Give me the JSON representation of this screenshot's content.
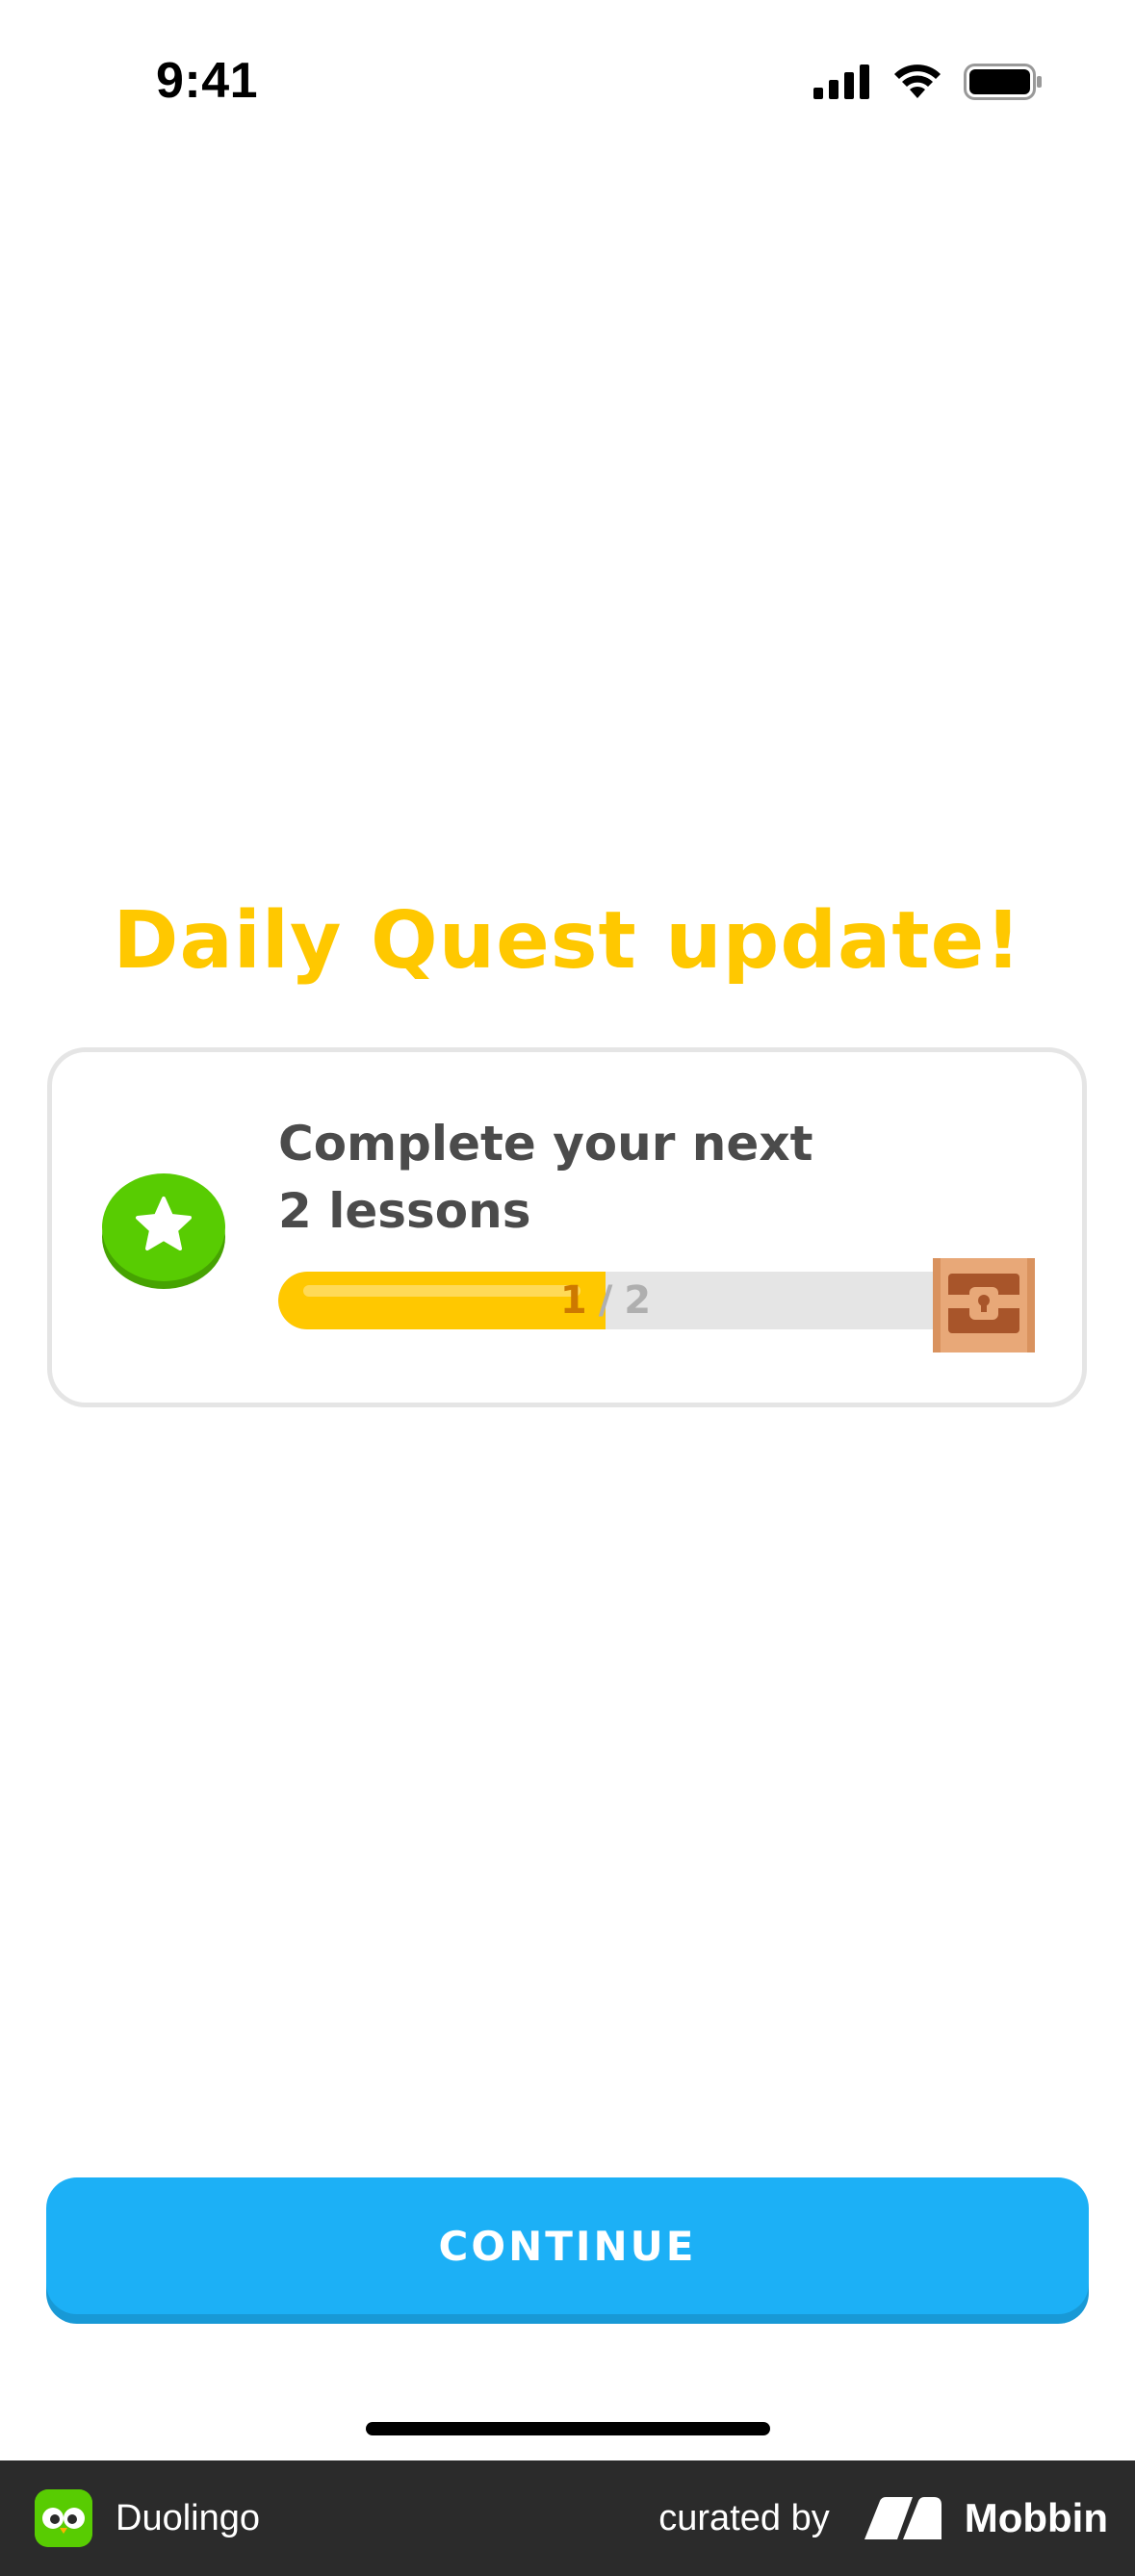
{
  "status_bar": {
    "time": "9:41"
  },
  "heading": "Daily Quest update!",
  "quest": {
    "title_line1": "Complete your next",
    "title_line2": "2 lessons",
    "progress": {
      "current": "1",
      "separator": "/",
      "total": "2",
      "fraction": 0.5
    },
    "icon": "star-badge-icon",
    "reward_icon": "treasure-chest-icon"
  },
  "continue_button": {
    "label": "CONTINUE"
  },
  "footer": {
    "app_name": "Duolingo",
    "curated_by": "curated by",
    "brand": "Mobbin"
  },
  "colors": {
    "heading": "#FFC800",
    "progress_fill": "#FFC800",
    "progress_track": "#E5E5E5",
    "button": "#1CB0F6",
    "star_badge": "#58CC02",
    "footer_bg": "#2B2B2B"
  }
}
